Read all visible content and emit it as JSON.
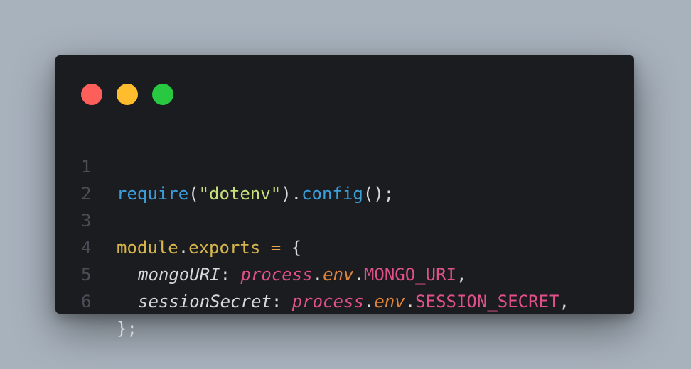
{
  "colors": {
    "background": "#a8b2bd",
    "editor_bg": "#1b1c20",
    "line_number": "#4a4d55",
    "default_text": "#d8d8d8",
    "function": "#3b9fdc",
    "string": "#c6e07a",
    "keyword_yellow": "#d6b64a",
    "operator": "#e6a84a",
    "property": "#d8d8d8",
    "pink": "#e0508a",
    "orange": "#e0843a",
    "dot_red": "#ff5f5a",
    "dot_yellow": "#ffbd2e",
    "dot_green": "#28c840"
  },
  "window_controls": [
    "close-dot",
    "minimize-dot",
    "maximize-dot"
  ],
  "code": {
    "line_numbers": [
      "1",
      "2",
      "3",
      "4",
      "5",
      "6"
    ],
    "line1": {
      "fn": "require",
      "open": "(",
      "str": "\"dotenv\"",
      "close": ").",
      "method": "config",
      "end": "();"
    },
    "line3": {
      "obj": "module",
      "dot": ".",
      "prop": "exports",
      "eq": " = ",
      "brace": "{"
    },
    "line4": {
      "key": "mongoURI",
      "colon": ": ",
      "proc": "process",
      "dot1": ".",
      "env": "env",
      "dot2": ".",
      "var": "MONGO_URI",
      "comma": ","
    },
    "line5": {
      "key": "sessionSecret",
      "colon": ": ",
      "proc": "process",
      "dot1": ".",
      "env": "env",
      "dot2": ".",
      "var": "SESSION_SECRET",
      "comma": ","
    },
    "line6": {
      "close": "};"
    }
  }
}
